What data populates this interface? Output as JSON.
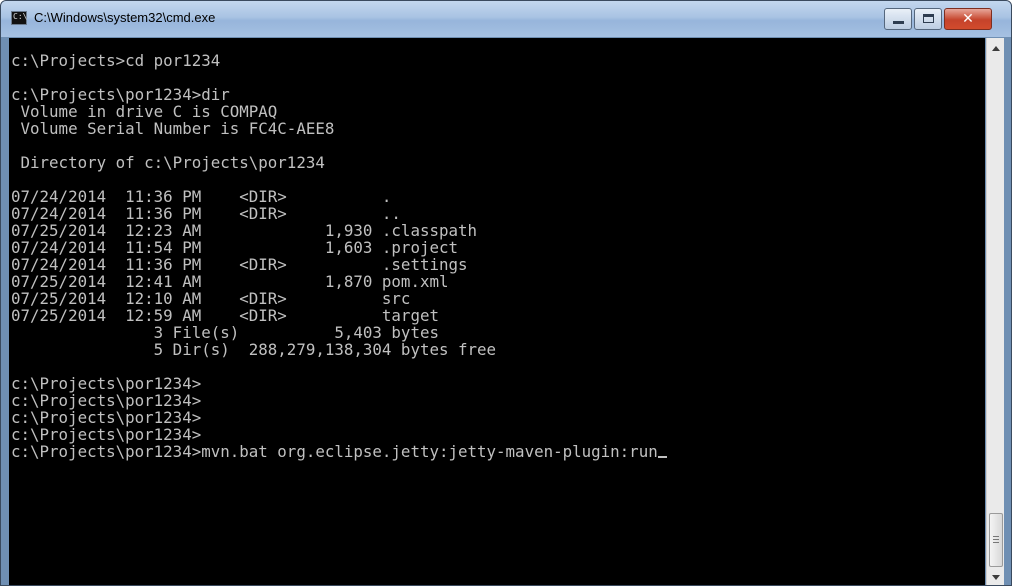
{
  "window": {
    "title": "C:\\Windows\\system32\\cmd.exe",
    "icon": "cmd-icon",
    "icon_text": "C:\\"
  },
  "controls": {
    "minimize": "minimize-icon",
    "maximize": "maximize-icon",
    "close": "close-icon",
    "close_glyph": "✕"
  },
  "console": {
    "lines": [
      "c:\\Projects>cd por1234",
      "",
      "c:\\Projects\\por1234>dir",
      " Volume in drive C is COMPAQ",
      " Volume Serial Number is FC4C-AEE8",
      "",
      " Directory of c:\\Projects\\por1234",
      "",
      "07/24/2014  11:36 PM    <DIR>          .",
      "07/24/2014  11:36 PM    <DIR>          ..",
      "07/25/2014  12:23 AM             1,930 .classpath",
      "07/24/2014  11:54 PM             1,603 .project",
      "07/24/2014  11:36 PM    <DIR>          .settings",
      "07/25/2014  12:41 AM             1,870 pom.xml",
      "07/25/2014  12:10 AM    <DIR>          src",
      "07/25/2014  12:59 AM    <DIR>          target",
      "               3 File(s)          5,403 bytes",
      "               5 Dir(s)  288,279,138,304 bytes free",
      "",
      "c:\\Projects\\por1234>",
      "c:\\Projects\\por1234>",
      "c:\\Projects\\por1234>",
      "c:\\Projects\\por1234>"
    ],
    "current_command": "c:\\Projects\\por1234>mvn.bat org.eclipse.jetty:jetty-maven-plugin:run",
    "text_color": "#c0c0c0",
    "background": "#000000"
  },
  "scrollbar": {
    "up": "scroll-up-arrow-icon",
    "down": "scroll-down-arrow-icon"
  }
}
